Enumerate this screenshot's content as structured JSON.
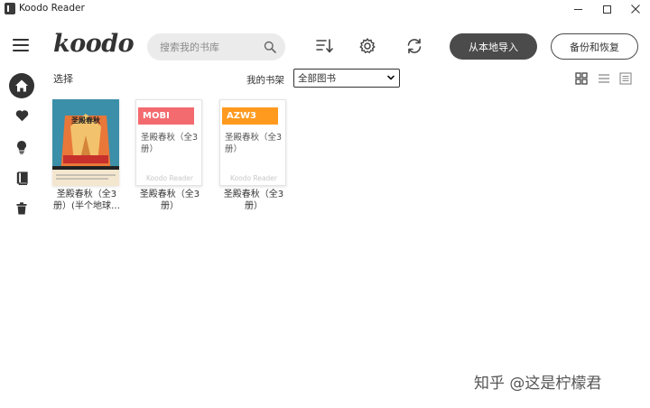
{
  "window": {
    "title": "Koodo Reader",
    "controls": [
      "minimize",
      "maximize",
      "close"
    ]
  },
  "header": {
    "logo": "koodo",
    "search_placeholder": "搜索我的书库",
    "import_label": "从本地导入",
    "backup_label": "备份和恢复"
  },
  "sidebar": {
    "items": [
      {
        "name": "home",
        "icon": "home-icon",
        "active": true
      },
      {
        "name": "favorites",
        "icon": "heart-icon",
        "active": false
      },
      {
        "name": "notes",
        "icon": "bulb-icon",
        "active": false
      },
      {
        "name": "bookmarks",
        "icon": "book-icon",
        "active": false
      },
      {
        "name": "trash",
        "icon": "trash-icon",
        "active": false
      }
    ]
  },
  "toolbar": {
    "select_label": "选择",
    "shelf_label": "我的书架",
    "shelf_selected": "全部图书",
    "views": [
      "grid-view-icon",
      "list-view-icon",
      "detail-view-icon"
    ]
  },
  "books": [
    {
      "type": "image",
      "name": "圣殿春秋（全3册）(半个地球…",
      "cover_title": "圣殿春秋"
    },
    {
      "type": "format",
      "format": "MOBI",
      "format_color": "#f36b6f",
      "cover_title": "圣殿春秋（全3册）",
      "cover_brand": "Koodo Reader",
      "name": "圣殿春秋（全3册）"
    },
    {
      "type": "format",
      "format": "AZW3",
      "format_color": "#ff9a1f",
      "cover_title": "圣殿春秋（全3册）",
      "cover_brand": "Koodo Reader",
      "name": "圣殿春秋（全3册）"
    }
  ],
  "watermark": "知乎 @这是柠檬君",
  "colors": {
    "accent_dark": "#4b4b4b",
    "mobi": "#f36b6f",
    "azw3": "#ff9a1f"
  }
}
